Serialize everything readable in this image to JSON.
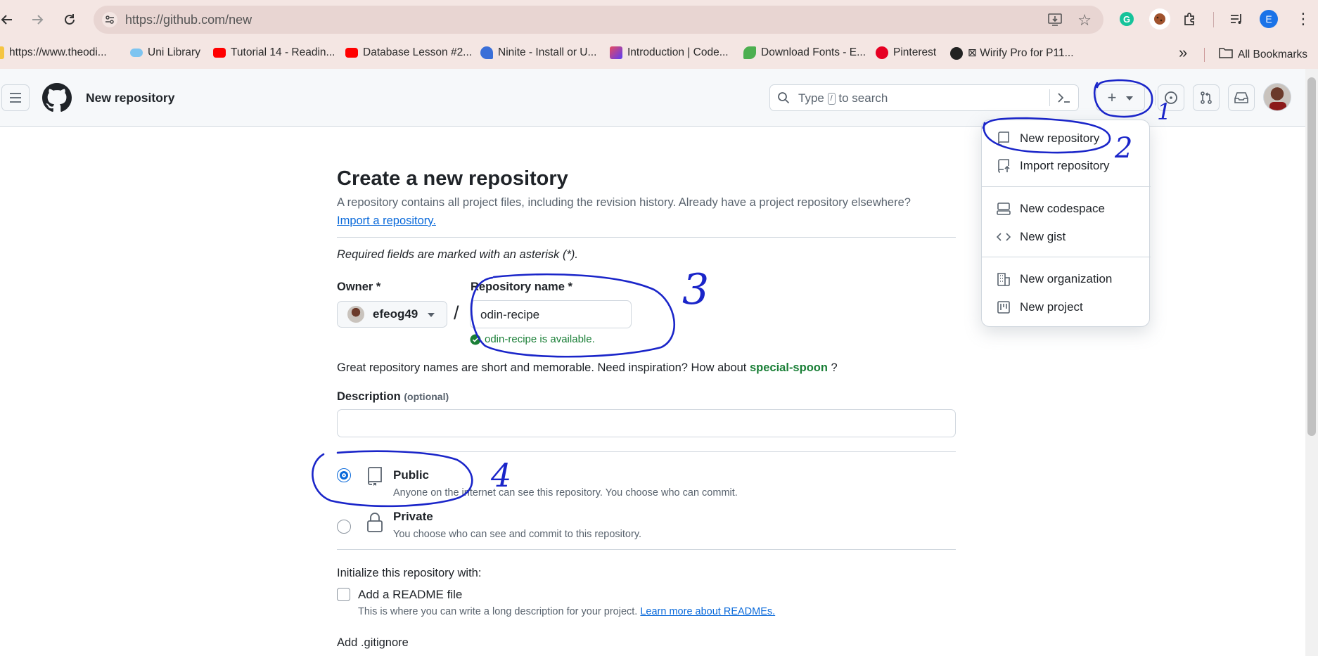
{
  "browser": {
    "url": "https://github.com/new",
    "profile_initial": "E",
    "bookmarks": [
      {
        "label": "https://www.theodi...",
        "icon": "page-icon"
      },
      {
        "label": "Uni Library",
        "icon": "cloud-icon"
      },
      {
        "label": "Tutorial 14 - Readin...",
        "icon": "youtube-icon"
      },
      {
        "label": "Database Lesson #2...",
        "icon": "youtube-icon"
      },
      {
        "label": "Ninite - Install or U...",
        "icon": "ninite-icon"
      },
      {
        "label": "Introduction | Code...",
        "icon": "code-icon"
      },
      {
        "label": "Download Fonts - E...",
        "icon": "leaf-icon"
      },
      {
        "label": "Pinterest",
        "icon": "pinterest-icon"
      },
      {
        "label": "⊠ Wirify Pro for P11...",
        "icon": "globe-icon"
      }
    ],
    "more_bookmarks": "»",
    "all_bookmarks": "All Bookmarks"
  },
  "header": {
    "title": "New repository",
    "search_prefix": "Type",
    "search_key": "/",
    "search_suffix": "to search"
  },
  "menu": {
    "items": [
      {
        "label": "New repository",
        "icon": "repo-icon"
      },
      {
        "label": "Import repository",
        "icon": "repo-push-icon"
      },
      {
        "label": "New codespace",
        "icon": "codespace-icon"
      },
      {
        "label": "New gist",
        "icon": "code-icon"
      },
      {
        "label": "New organization",
        "icon": "organization-icon"
      },
      {
        "label": "New project",
        "icon": "project-icon"
      }
    ]
  },
  "form": {
    "heading": "Create a new repository",
    "intro": "A repository contains all project files, including the revision history. Already have a project repository elsewhere?",
    "import_link": "Import a repository.",
    "required_note": "Required fields are marked with an asterisk (*).",
    "owner_label": "Owner *",
    "owner_value": "efeog49",
    "slash": "/",
    "repo_name_label": "Repository name *",
    "repo_name_value": "odin-recipe",
    "availability": "odin-recipe is available.",
    "suggestion_prefix": "Great repository names are short and memorable. Need inspiration? How about",
    "suggestion_name": "special-spoon",
    "suggestion_suffix": "?",
    "description_label": "Description",
    "description_optional": "(optional)",
    "description_value": "",
    "visibility": {
      "selected": "Public",
      "public_label": "Public",
      "public_desc": "Anyone on the internet can see this repository. You choose who can commit.",
      "private_label": "Private",
      "private_desc": "You choose who can see and commit to this repository."
    },
    "init_heading": "Initialize this repository with:",
    "readme_label": "Add a README file",
    "readme_checked": false,
    "readme_desc": "This is where you can write a long description for your project.",
    "readme_link": "Learn more about READMEs.",
    "gitignore_label": "Add .gitignore"
  },
  "annotations": [
    "1",
    "2",
    "3",
    "4"
  ],
  "colors": {
    "annotation": "#1a25c9",
    "success": "#1a7f37",
    "link": "#0969da",
    "radio_selected": "#0969da"
  }
}
